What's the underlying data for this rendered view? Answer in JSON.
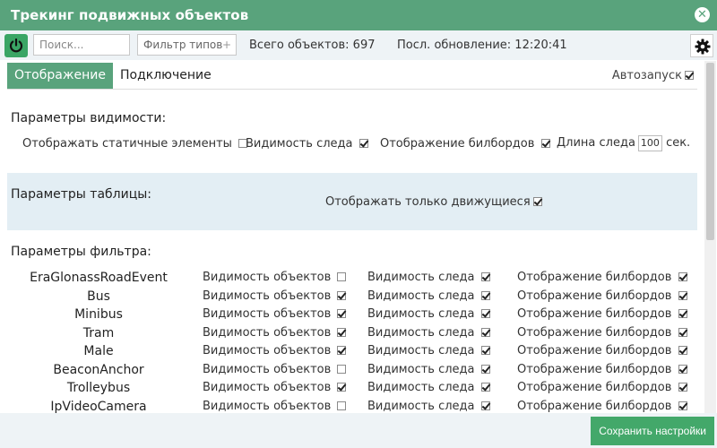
{
  "window": {
    "title": "Трекинг подвижных объектов"
  },
  "toolbar": {
    "search_placeholder": "Поиск...",
    "type_filter_label": "Фильтр типов",
    "type_filter_plus": "+",
    "total_objects": "Всего объектов: 697",
    "last_update": "Посл. обновление: 12:20:41"
  },
  "tabs": [
    {
      "label": "Отображение",
      "active": true
    },
    {
      "label": "Подключение",
      "active": false
    }
  ],
  "autostart": {
    "label": "Автозапуск",
    "checked": true
  },
  "visibility": {
    "title": "Параметры видимости:",
    "static_label": "Отображать статичные элементы",
    "static_checked": false,
    "trail_label": "Видимость следа",
    "trail_checked": true,
    "billboards_label": "Отображение билбордов",
    "billboards_checked": true,
    "trail_length_label": "Длина следа",
    "trail_length_value": "100",
    "trail_length_unit": "сек."
  },
  "table_params": {
    "title": "Параметры таблицы:",
    "moving_only_label": "Отображать только движущиеся",
    "moving_only_checked": true
  },
  "filter_params": {
    "title": "Параметры фильтра:",
    "col_objects": "Видимость объектов",
    "col_trail": "Видимость следа",
    "col_billboards": "Отображение билбордов",
    "rows": [
      {
        "name": "EraGlonassRoadEvent",
        "objects": false,
        "trail": true,
        "billboards": true
      },
      {
        "name": "Bus",
        "objects": true,
        "trail": true,
        "billboards": true
      },
      {
        "name": "Minibus",
        "objects": true,
        "trail": true,
        "billboards": true
      },
      {
        "name": "Tram",
        "objects": true,
        "trail": true,
        "billboards": true
      },
      {
        "name": "Male",
        "objects": true,
        "trail": true,
        "billboards": true
      },
      {
        "name": "BeaconAnchor",
        "objects": false,
        "trail": true,
        "billboards": true
      },
      {
        "name": "Trolleybus",
        "objects": true,
        "trail": true,
        "billboards": true
      },
      {
        "name": "IpVideoCamera",
        "objects": false,
        "trail": true,
        "billboards": true
      }
    ]
  },
  "footer": {
    "save_label": "Сохранить настройки"
  },
  "colors": {
    "accent": "#59a37c",
    "save_button": "#43a86a",
    "toolbar_bg": "#eef3f6",
    "table_section_bg": "#e3eef4"
  }
}
